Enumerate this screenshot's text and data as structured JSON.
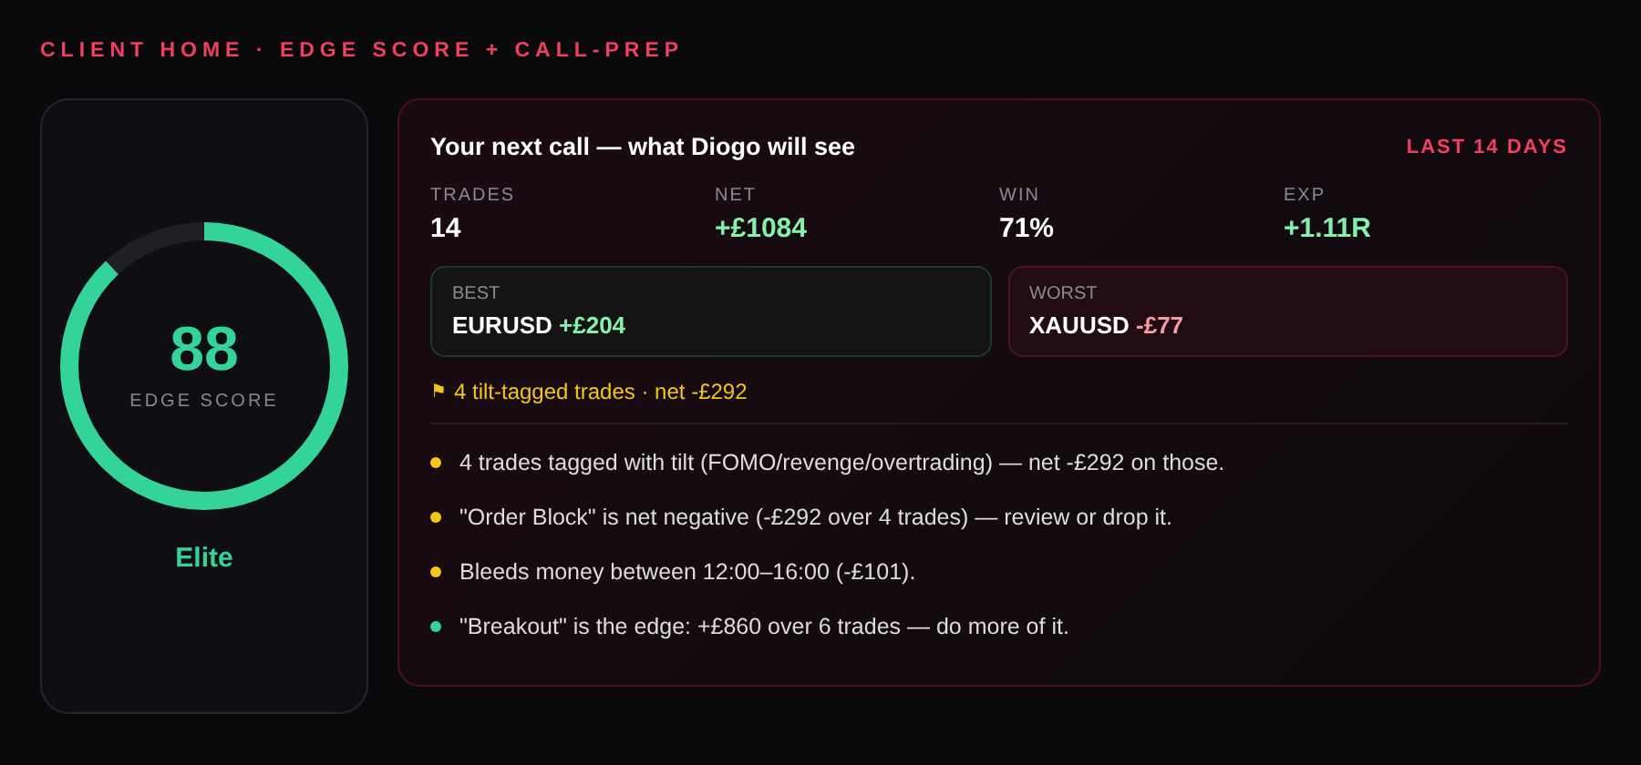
{
  "heading": "CLIENT HOME · EDGE SCORE + CALL-PREP",
  "score": {
    "value": "88",
    "label": "EDGE SCORE",
    "level": 0.88,
    "tier": "Elite"
  },
  "call": {
    "title": "Your next call — what Diogo will see",
    "period": "LAST 14 DAYS",
    "stats": [
      {
        "label": "TRADES",
        "value": "14",
        "positive": false
      },
      {
        "label": "NET",
        "value": "+£1084",
        "positive": true
      },
      {
        "label": "WIN",
        "value": "71%",
        "positive": false
      },
      {
        "label": "EXP",
        "value": "+1.11R",
        "positive": true
      }
    ],
    "trades": [
      {
        "kind": "best",
        "label": "BEST",
        "symbol": "EURUSD",
        "pnl": "+£204"
      },
      {
        "kind": "worst",
        "label": "WORST",
        "symbol": "XAUUSD",
        "pnl": "-£77"
      }
    ],
    "tilt": {
      "icon": "⚑",
      "text": "4 tilt-tagged trades · net -£292"
    },
    "insights": [
      {
        "text": "4 trades tagged with tilt (FOMO/revenge/overtrading) — net -£292 on those.",
        "color": "#f5c518"
      },
      {
        "text": "\"Order Block\" is net negative (-£292 over 4 trades) — review or drop it.",
        "color": "#f5c518"
      },
      {
        "text": "Bleeds money between 12:00–16:00 (-£101).",
        "color": "#f5c518"
      },
      {
        "text": "\"Breakout\" is the edge: +£860 over 6 trades — do more of it.",
        "color": "#34d399"
      }
    ]
  }
}
